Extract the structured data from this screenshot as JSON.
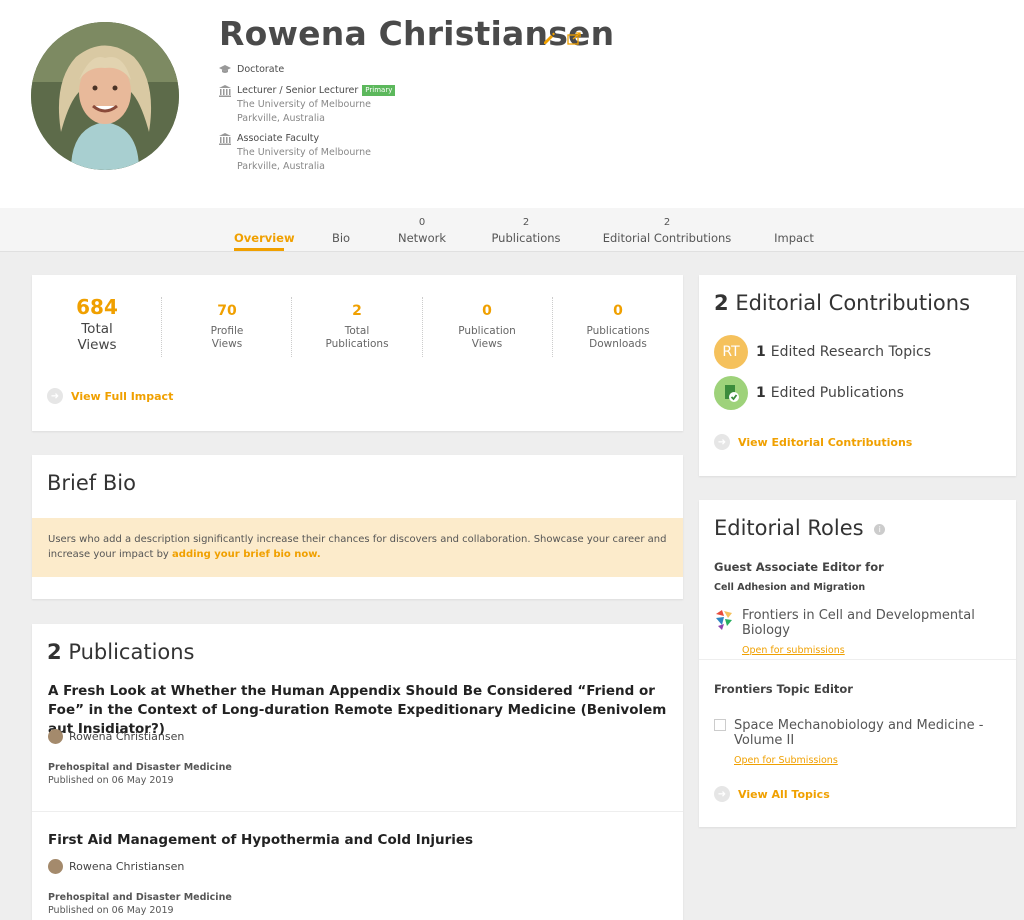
{
  "profile": {
    "name": "Rowena Christiansen",
    "degree": "Doctorate",
    "positions": [
      {
        "title": "Lecturer / Senior Lecturer",
        "badge": "Primary",
        "institution": "The University of Melbourne",
        "location": "Parkville, Australia"
      },
      {
        "title": "Associate Faculty",
        "institution": "The University of Melbourne",
        "location": "Parkville, Australia"
      }
    ]
  },
  "tabs": [
    {
      "label": "Overview",
      "count": ""
    },
    {
      "label": "Bio",
      "count": ""
    },
    {
      "label": "Network",
      "count": "0"
    },
    {
      "label": "Publications",
      "count": "2"
    },
    {
      "label": "Editorial Contributions",
      "count": "2"
    },
    {
      "label": "Impact",
      "count": ""
    }
  ],
  "impact": {
    "metrics": [
      {
        "value": "684",
        "label1": "Total",
        "label2": "Views"
      },
      {
        "value": "70",
        "label1": "Profile",
        "label2": "Views"
      },
      {
        "value": "2",
        "label1": "Total",
        "label2": "Publications"
      },
      {
        "value": "0",
        "label1": "Publication",
        "label2": "Views"
      },
      {
        "value": "0",
        "label1": "Publications",
        "label2": "Downloads"
      }
    ],
    "link": "View Full Impact"
  },
  "bio": {
    "title": "Brief Bio",
    "banner_text": "Users who add a description significantly increase their chances for discovers and collaboration. Showcase your career and increase your impact by ",
    "banner_link": "adding your brief bio now."
  },
  "publications": {
    "count": "2",
    "title": "Publications",
    "items": [
      {
        "title": "A Fresh Look at Whether the Human Appendix Should Be Considered “Friend or Foe” in the Context of Long-duration Remote Expeditionary Medicine (Benivolem aut Insidiator?)",
        "author": "Rowena Christiansen",
        "journal": "Prehospital and Disaster Medicine",
        "date": "Published on 06 May 2019"
      },
      {
        "title": "First Aid Management of Hypothermia and Cold Injuries",
        "author": "Rowena Christiansen",
        "journal": "Prehospital and Disaster Medicine",
        "date": "Published on 06 May 2019"
      }
    ]
  },
  "editorial": {
    "count": "2",
    "title": "Editorial Contributions",
    "rows": [
      {
        "icon_text": "RT",
        "count": "1",
        "label": "Edited Research Topics"
      },
      {
        "icon_text": "",
        "count": "1",
        "label": "Edited Publications"
      }
    ],
    "link": "View Editorial Contributions"
  },
  "roles": {
    "title": "Editorial Roles",
    "guest_heading": "Guest Associate Editor for",
    "guest_section": "Cell Adhesion and Migration",
    "guest_journal": "Frontiers in Cell and Developmental Biology",
    "guest_status": "Open for submissions",
    "topic_heading": "Frontiers Topic Editor",
    "topic_title_1": "Space Mechanobiology and Medicine -",
    "topic_title_2": "Volume II",
    "topic_status": "Open for Submissions",
    "link": "View All Topics"
  },
  "colors": {
    "accent": "#f0a000",
    "primary_badge": "#5cb85c",
    "banner": "#fcebcb",
    "rt_circle": "#f5c15c",
    "pub_circle": "#9ed27a"
  }
}
